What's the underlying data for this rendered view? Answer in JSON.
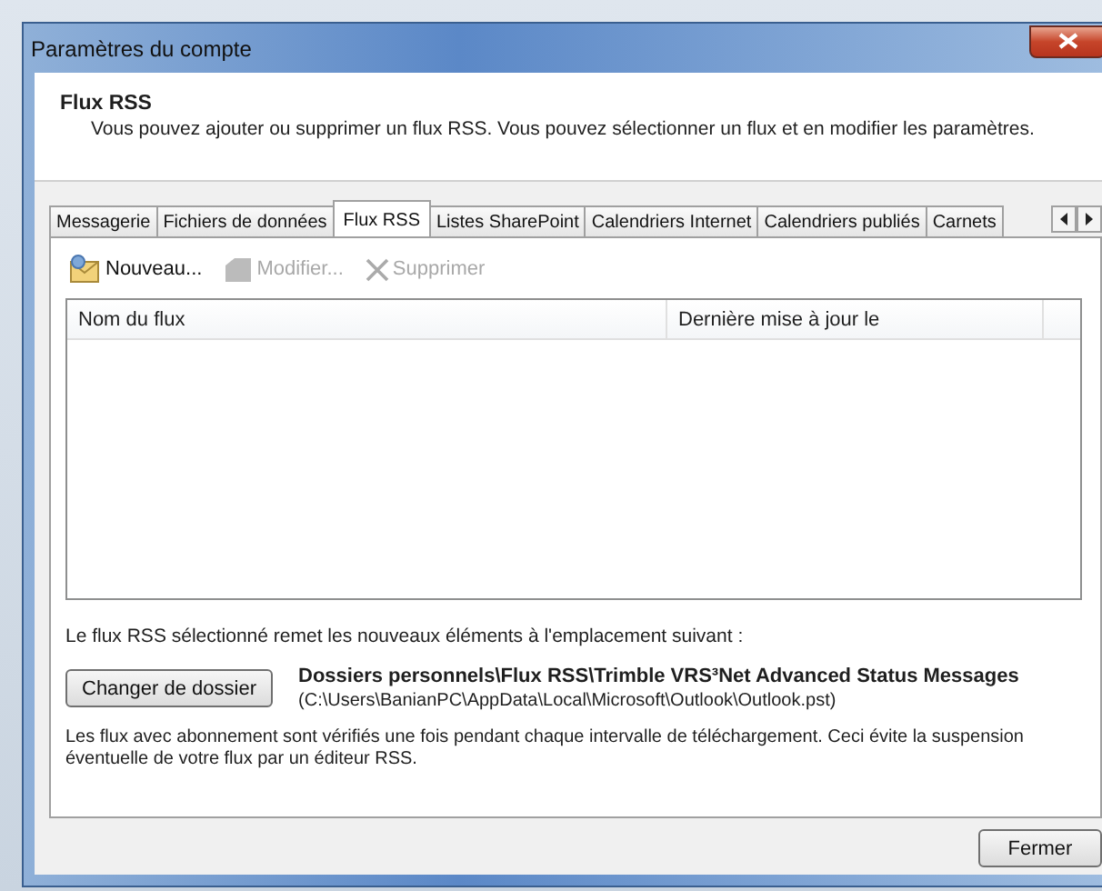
{
  "window": {
    "title": "Paramètres du compte"
  },
  "header": {
    "title": "Flux RSS",
    "description": "Vous pouvez ajouter ou supprimer un flux RSS. Vous pouvez sélectionner un flux et en modifier les paramètres."
  },
  "tabs": [
    {
      "label": "Messagerie",
      "selected": false
    },
    {
      "label": "Fichiers de données",
      "selected": false
    },
    {
      "label": "Flux RSS",
      "selected": true
    },
    {
      "label": "Listes SharePoint",
      "selected": false
    },
    {
      "label": "Calendriers Internet",
      "selected": false
    },
    {
      "label": "Calendriers publiés",
      "selected": false
    },
    {
      "label": "Carnets",
      "selected": false
    }
  ],
  "toolbar": [
    {
      "kind": "new",
      "label": "Nouveau...",
      "disabled": false
    },
    {
      "kind": "edit",
      "label": "Modifier...",
      "disabled": true
    },
    {
      "kind": "delete",
      "label": "Supprimer",
      "disabled": true
    }
  ],
  "table": {
    "columns": [
      "Nom du flux",
      "Dernière mise à jour le"
    ]
  },
  "delivery": {
    "label": "Le flux RSS sélectionné remet les nouveaux éléments à l'emplacement suivant :",
    "button": "Changer de dossier",
    "folder": "Dossiers personnels\\Flux RSS\\Trimble VRS³Net Advanced Status Messages",
    "path": "(C:\\Users\\BanianPC\\AppData\\Local\\Microsoft\\Outlook\\Outlook.pst)"
  },
  "note": "Les flux avec abonnement sont vérifiés une fois pendant chaque intervalle de téléchargement. Ceci évite la suspension éventuelle de votre flux par un éditeur RSS.",
  "buttons": [
    "Fermer"
  ]
}
